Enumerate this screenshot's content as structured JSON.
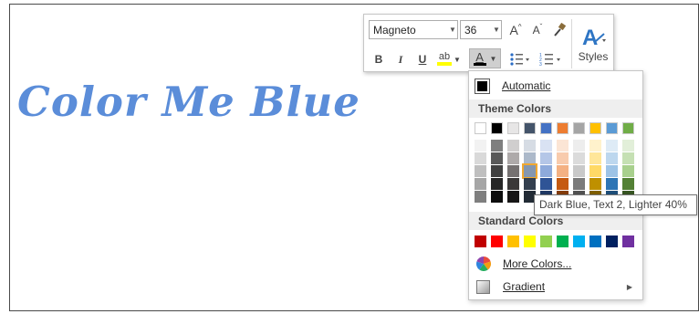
{
  "document": {
    "text": "Color Me Blue",
    "text_color": "#5b8dd9"
  },
  "toolbar": {
    "font_name": "Magneto",
    "font_size": "36",
    "grow_font_label": "A",
    "shrink_font_label": "A",
    "bold_label": "B",
    "italic_label": "I",
    "underline_label": "U",
    "highlight_label": "ab",
    "font_color_label": "A",
    "styles_label": "Styles",
    "font_color_underline": "#000000",
    "highlight_underline": "#ffff00"
  },
  "color_menu": {
    "automatic_label": "Automatic",
    "theme_colors_label": "Theme Colors",
    "standard_colors_label": "Standard Colors",
    "more_colors_label": "More Colors...",
    "gradient_label": "Gradient",
    "tooltip": "Dark Blue, Text 2, Lighter 40%",
    "selected_swatch": "Dark Blue, Text 2, Lighter 40%",
    "theme_top_row": [
      "#ffffff",
      "#000000",
      "#e7e6e6",
      "#44546a",
      "#4472c4",
      "#ed7d31",
      "#a5a5a5",
      "#ffc000",
      "#5b9bd5",
      "#70ad47"
    ],
    "theme_columns": [
      [
        "#f2f2f2",
        "#d9d9d9",
        "#bfbfbf",
        "#a6a6a6",
        "#7f7f7f"
      ],
      [
        "#7f7f7f",
        "#595959",
        "#404040",
        "#262626",
        "#0d0d0d"
      ],
      [
        "#d0cece",
        "#aeaaaa",
        "#757171",
        "#3a3838",
        "#171616"
      ],
      [
        "#d6dce4",
        "#acb9ca",
        "#8497b0",
        "#333f4f",
        "#222b35"
      ],
      [
        "#d9e2f3",
        "#b4c6e7",
        "#8eaadb",
        "#2f5496",
        "#1f3864"
      ],
      [
        "#fbe5d5",
        "#f8cbad",
        "#f4b183",
        "#c55a11",
        "#833c0b"
      ],
      [
        "#ededed",
        "#dbdbdb",
        "#c9c9c9",
        "#7b7b7b",
        "#525252"
      ],
      [
        "#fff2cc",
        "#ffe699",
        "#ffd966",
        "#bf9000",
        "#7f6000"
      ],
      [
        "#deebf6",
        "#bdd7ee",
        "#9dc3e6",
        "#2e75b5",
        "#1e4e79"
      ],
      [
        "#e2efd9",
        "#c5e0b3",
        "#a8d08d",
        "#538135",
        "#375623"
      ]
    ],
    "standard_colors": [
      "#c00000",
      "#ff0000",
      "#ffc000",
      "#ffff00",
      "#92d050",
      "#00b050",
      "#00b0f0",
      "#0070c0",
      "#002060",
      "#7030a0"
    ]
  }
}
